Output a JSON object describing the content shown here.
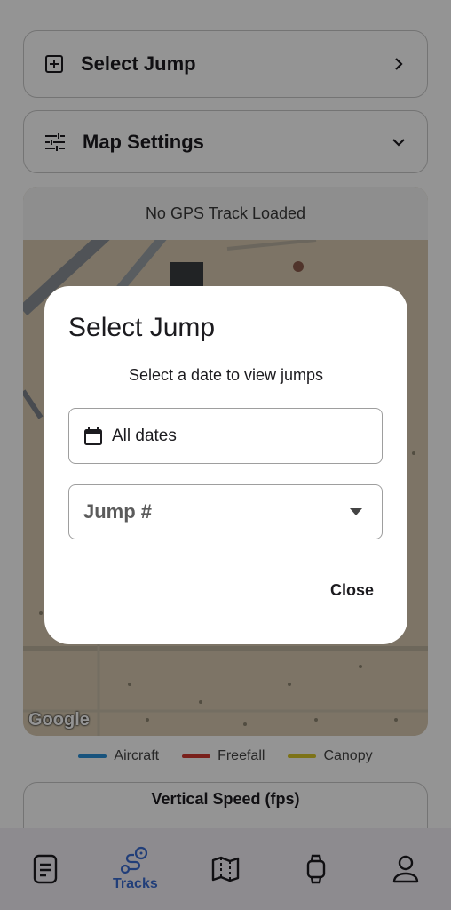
{
  "cards": {
    "select_jump": {
      "label": "Select Jump",
      "icon": "add-box-icon",
      "trailing_icon": "chevron-right-icon"
    },
    "map_settings": {
      "label": "Map Settings",
      "icon": "tune-sliders-icon",
      "trailing_icon": "chevron-down-icon"
    }
  },
  "map": {
    "status": "No GPS Track Loaded",
    "attribution": "Google"
  },
  "legend": [
    {
      "label": "Aircraft",
      "color": "#2a8fd8"
    },
    {
      "label": "Freefall",
      "color": "#d0372f"
    },
    {
      "label": "Canopy",
      "color": "#d8c62a"
    }
  ],
  "chart": {
    "title": "Vertical Speed (fps)"
  },
  "nav": {
    "items": [
      {
        "name": "document-icon",
        "label": ""
      },
      {
        "name": "tracks-icon",
        "label": "Tracks"
      },
      {
        "name": "map-icon",
        "label": ""
      },
      {
        "name": "watch-icon",
        "label": ""
      },
      {
        "name": "person-icon",
        "label": ""
      }
    ],
    "accent": "#3a6bd1"
  },
  "dialog": {
    "title": "Select Jump",
    "subtitle": "Select a date to view jumps",
    "date_value": "All dates",
    "jump_placeholder": "Jump #",
    "close_label": "Close"
  }
}
